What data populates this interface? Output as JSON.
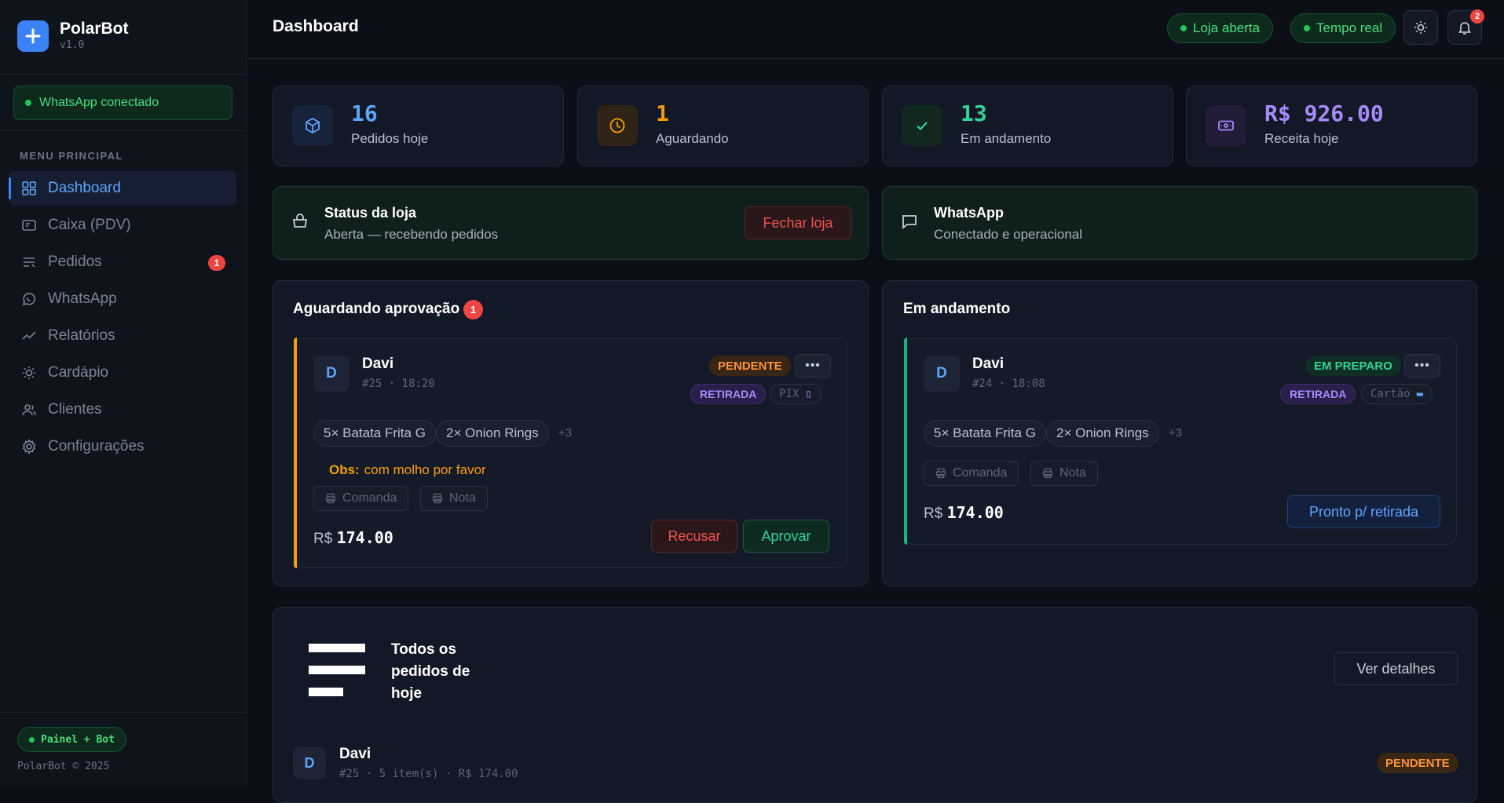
{
  "brand": {
    "name": "PolarBot",
    "version": "v1.0"
  },
  "sidebar": {
    "whatsapp_status": "WhatsApp conectado",
    "menu_title": "MENU PRINCIPAL",
    "items": [
      {
        "label": "Dashboard",
        "icon": "grid-icon",
        "active": true
      },
      {
        "label": "Caixa (PDV)",
        "icon": "register-icon"
      },
      {
        "label": "Pedidos",
        "icon": "list-icon",
        "badge": "1"
      },
      {
        "label": "WhatsApp",
        "icon": "whatsapp-icon"
      },
      {
        "label": "Relatórios",
        "icon": "chart-line-icon"
      },
      {
        "label": "Cardápio",
        "icon": "sun-icon"
      },
      {
        "label": "Clientes",
        "icon": "users-icon"
      },
      {
        "label": "Configurações",
        "icon": "gear-icon"
      }
    ],
    "footer_badge": "Painel + Bot",
    "copyright": "PolarBot © 2025"
  },
  "topbar": {
    "title": "Dashboard",
    "store_status": "Loja aberta",
    "realtime": "Tempo real",
    "notification_count": "2"
  },
  "stats": [
    {
      "value": "16",
      "label": "Pedidos hoje",
      "color": "#60a5fa",
      "icon": "box-icon"
    },
    {
      "value": "1",
      "label": "Aguardando",
      "color": "#f59e0b",
      "icon": "clock-icon"
    },
    {
      "value": "13",
      "label": "Em andamento",
      "color": "#34d399",
      "icon": "check-icon"
    },
    {
      "value": "R$ 926.00",
      "label": "Receita hoje",
      "color": "#a78bfa",
      "icon": "money-icon"
    }
  ],
  "store_card": {
    "title": "Status da loja",
    "subtitle": "Aberta — recebendo pedidos",
    "button": "Fechar loja"
  },
  "whatsapp_card": {
    "title": "WhatsApp",
    "subtitle": "Conectado e operacional"
  },
  "pending_section": {
    "title": "Aguardando aprovação",
    "count": "1",
    "order": {
      "initial": "D",
      "name": "Davi",
      "meta": "#25 · 18:20",
      "status": "PENDENTE",
      "type": "RETIRADA",
      "payment": "PIX",
      "items": [
        "5× Batata Frita G",
        "2× Onion Rings"
      ],
      "more": "+3",
      "obs_label": "Obs:",
      "obs_text": "com molho por favor",
      "print_1": "Comanda",
      "print_2": "Nota",
      "currency": "R$",
      "total": "174.00",
      "reject": "Recusar",
      "approve": "Aprovar"
    }
  },
  "progress_section": {
    "title": "Em andamento",
    "order": {
      "initial": "D",
      "name": "Davi",
      "meta": "#24 · 18:08",
      "status": "EM PREPARO",
      "type": "RETIRADA",
      "payment": "Cartão",
      "items": [
        "5× Batata Frita G",
        "2× Onion Rings"
      ],
      "more": "+3",
      "print_1": "Comanda",
      "print_2": "Nota",
      "currency": "R$",
      "total": "174.00",
      "ready": "Pronto p/ retirada"
    }
  },
  "all_orders": {
    "title": "Todos os pedidos de hoje",
    "details_button": "Ver detalhes",
    "rows": [
      {
        "initial": "D",
        "name": "Davi",
        "meta": "#25 · 5 item(s) · R$ 174.00",
        "status": "PENDENTE"
      }
    ]
  }
}
